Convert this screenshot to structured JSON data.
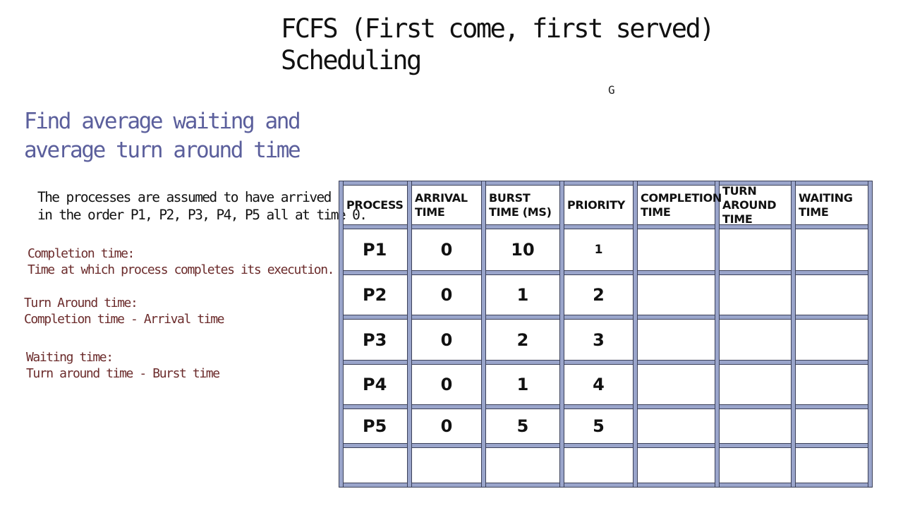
{
  "title": {
    "line1": "FCFS (First come, first served)",
    "line2": "Scheduling"
  },
  "stray_glyph": "G",
  "subtitle": {
    "line1": "Find average waiting and",
    "line2": "average turn around time"
  },
  "assumption": {
    "line1": "The processes are assumed to have arrived",
    "line2": "in the order P1, P2, P3, P4, P5 all at time 0."
  },
  "definitions": [
    {
      "term": "Completion time:",
      "text": "Time at which process completes its execution."
    },
    {
      "term": "Turn Around time:",
      "text": "Completion time - Arrival time"
    },
    {
      "term": "Waiting time:",
      "text": "Turn around time - Burst time"
    }
  ],
  "table": {
    "headers": [
      [
        "PROCESS"
      ],
      [
        "ARRIVAL",
        "TIME"
      ],
      [
        "BURST",
        "TIME (MS)"
      ],
      [
        "PRIORITY"
      ],
      [
        "COMPLETION",
        "TIME"
      ],
      [
        "TURN",
        "AROUND",
        "TIME"
      ],
      [
        "WAITING",
        "TIME"
      ]
    ],
    "rows": [
      {
        "process": "P1",
        "arrival": "0",
        "burst": "10",
        "priority": "1",
        "completion": "",
        "turnaround": "",
        "waiting": ""
      },
      {
        "process": "P2",
        "arrival": "0",
        "burst": "1",
        "priority": "2",
        "completion": "",
        "turnaround": "",
        "waiting": ""
      },
      {
        "process": "P3",
        "arrival": "0",
        "burst": "2",
        "priority": "3",
        "completion": "",
        "turnaround": "",
        "waiting": ""
      },
      {
        "process": "P4",
        "arrival": "0",
        "burst": "1",
        "priority": "4",
        "completion": "",
        "turnaround": "",
        "waiting": ""
      },
      {
        "process": "P5",
        "arrival": "0",
        "burst": "5",
        "priority": "5",
        "completion": "",
        "turnaround": "",
        "waiting": ""
      },
      {
        "process": "",
        "arrival": "",
        "burst": "",
        "priority": "",
        "completion": "",
        "turnaround": "",
        "waiting": ""
      }
    ]
  },
  "colors": {
    "title": "#111111",
    "subtitle": "#5b5f9c",
    "definitions": "#6b2b2b",
    "grid_fill": "#9aa5cb",
    "grid_outline": "#3b4058"
  }
}
